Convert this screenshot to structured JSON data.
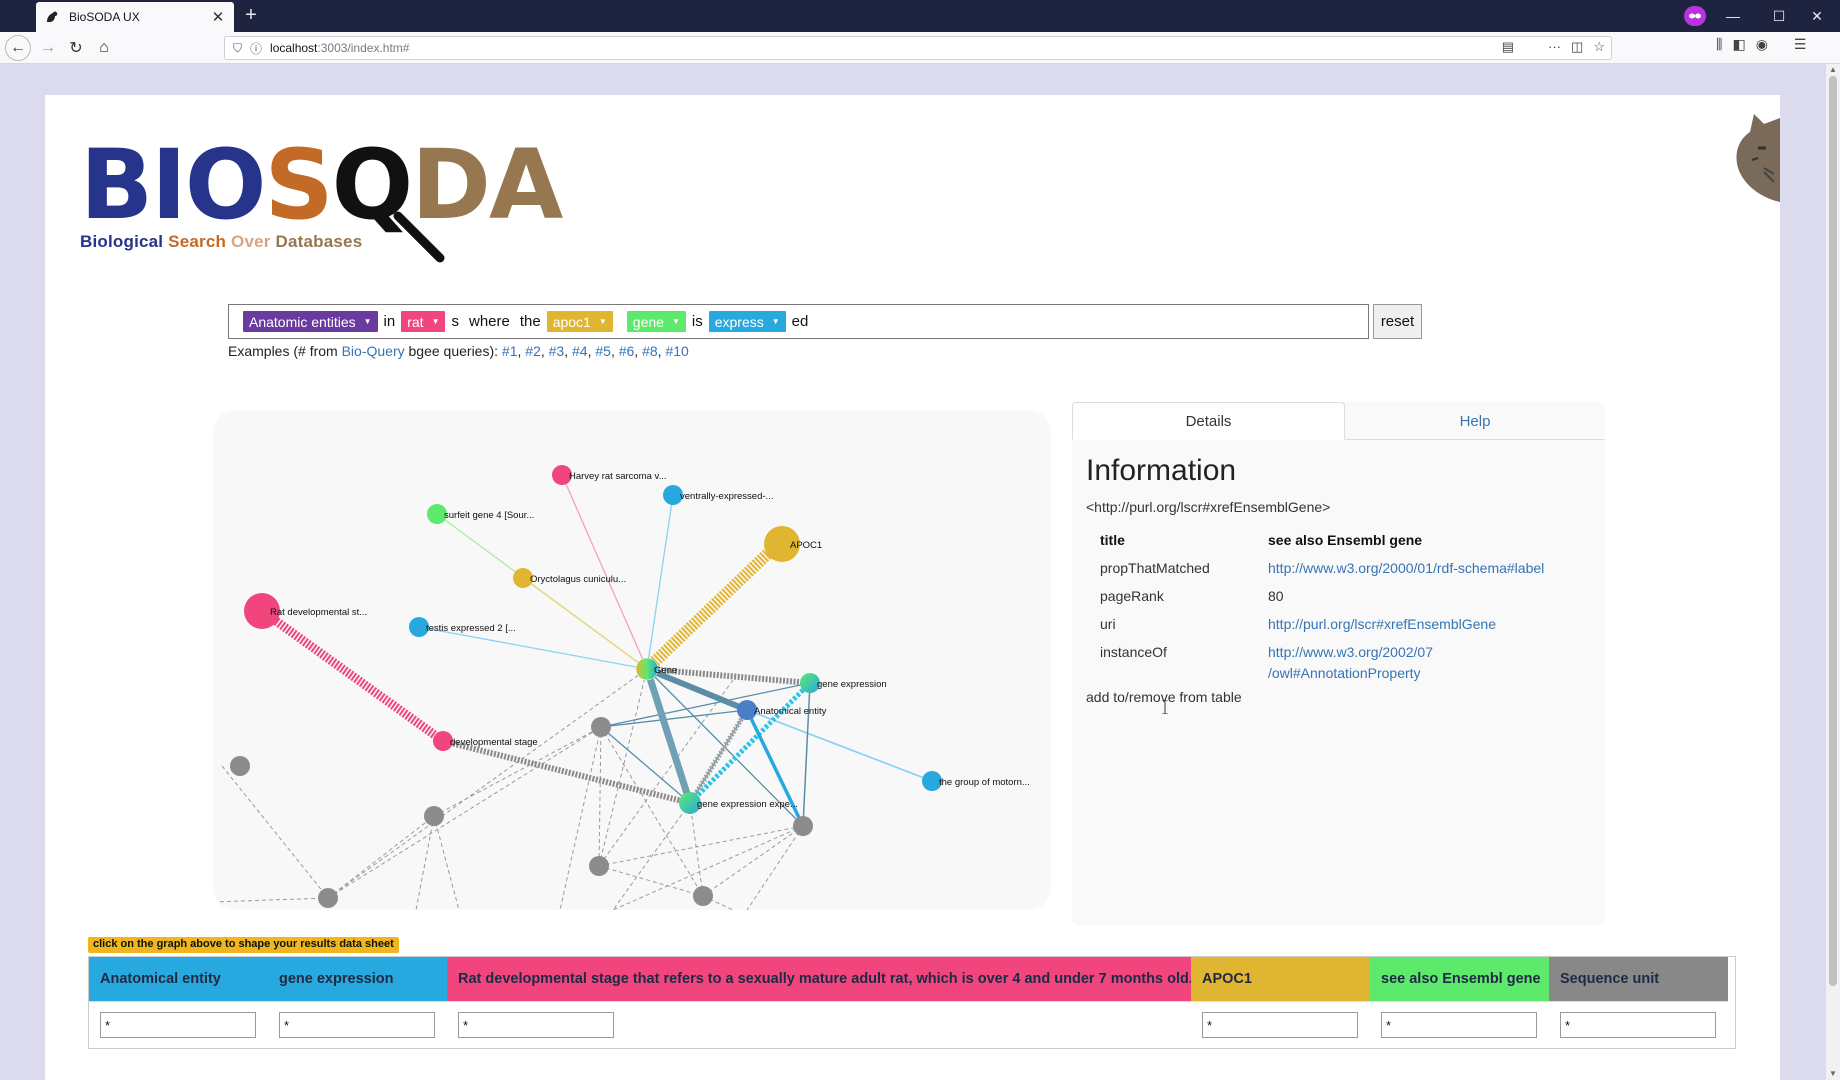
{
  "browser": {
    "tab_title": "BioSODA UX",
    "url_host": "localhost",
    "url_path": ":3003/index.htm#"
  },
  "logo": {
    "letters": [
      "BIO",
      "S",
      "Q",
      "DA"
    ],
    "subtitle": [
      "Biological",
      "Search",
      "Over",
      "Databases"
    ],
    "colors": {
      "bio": "#26348b",
      "s": "#c26a26",
      "q": "#111111",
      "da": "#97774f",
      "over": "#d8a583"
    }
  },
  "query": {
    "chips": [
      {
        "label": "Anatomic entities",
        "color": "#6a3a9e"
      },
      {
        "label": "rat",
        "color": "#f0467d"
      },
      {
        "label": "apoc1",
        "color": "#e0b531"
      },
      {
        "label": "gene",
        "color": "#5de96c"
      },
      {
        "label": "express",
        "color": "#27a9df"
      }
    ],
    "words": [
      "in",
      "s",
      "where",
      "the",
      "is",
      "ed"
    ],
    "reset_label": "reset"
  },
  "examples": {
    "prefix": "Examples (# from",
    "link": "Bio-Query",
    "middle": "bgee queries):",
    "items": [
      "#1",
      "#2",
      "#3",
      "#4",
      "#5",
      "#6",
      "#8",
      "#10"
    ]
  },
  "graph": {
    "nodes": [
      {
        "label": "Harvey rat sarcoma v...",
        "color": "#f0467d"
      },
      {
        "label": "ventrally-expressed-...",
        "color": "#27a9df"
      },
      {
        "label": "surfeit gene 4 [Sour...",
        "color": "#5de96c"
      },
      {
        "label": "APOC1",
        "color": "#e0b531"
      },
      {
        "label": "Oryctolagus cuniculu...",
        "color": "#e0b531"
      },
      {
        "label": "Rat developmental st...",
        "color": "#f0467d"
      },
      {
        "label": "testis expressed 2 [...",
        "color": "#27a9df"
      },
      {
        "label": "Gene",
        "color": "#e0b531"
      },
      {
        "label": "gene expression",
        "color": "#27a9df"
      },
      {
        "label": "Anatomical entity",
        "color": "#27a9df"
      },
      {
        "label": "developmental stage",
        "color": "#f0467d"
      },
      {
        "label": "the group of motorn...",
        "color": "#27a9df"
      },
      {
        "label": "gene expression expe...",
        "color": "#27a9df"
      }
    ]
  },
  "details": {
    "tabs": [
      "Details",
      "Help"
    ],
    "heading": "Information",
    "uri": "<http://purl.org/lscr#xrefEnsemblGene>",
    "rows": [
      {
        "key": "title",
        "value": "see also Ensembl gene",
        "link": false
      },
      {
        "key": "propThatMatched",
        "value": "http://www.w3.org/2000/01/rdf-schema#label",
        "link": true
      },
      {
        "key": "pageRank",
        "value": "80",
        "link": false
      },
      {
        "key": "uri",
        "value": "http://purl.org/lscr#xrefEnsemblGene",
        "link": true
      },
      {
        "key": "instanceOf",
        "value": "http://www.w3.org/2002/07\n/owl#AnnotationProperty",
        "link": true
      }
    ],
    "add_remove": "add to/remove from table"
  },
  "results": {
    "hint": "click on the graph above to shape your results data sheet",
    "columns": [
      {
        "header": "Anatomical entity",
        "color": "#27a9df",
        "filter": "*"
      },
      {
        "header": "gene expression",
        "color": "#27a9df",
        "filter": "*"
      },
      {
        "header": "Rat developmental stage that refers to a sexually mature adult rat, which is over 4 and under 7 months old.",
        "color": "#f0467d",
        "filter": "*"
      },
      {
        "header": "APOC1",
        "color": "#e0b531",
        "filter": "*"
      },
      {
        "header": "see also Ensembl gene",
        "color": "#5de96c",
        "filter": "*"
      },
      {
        "header": "Sequence unit",
        "color": "#888888",
        "filter": "*"
      }
    ]
  }
}
